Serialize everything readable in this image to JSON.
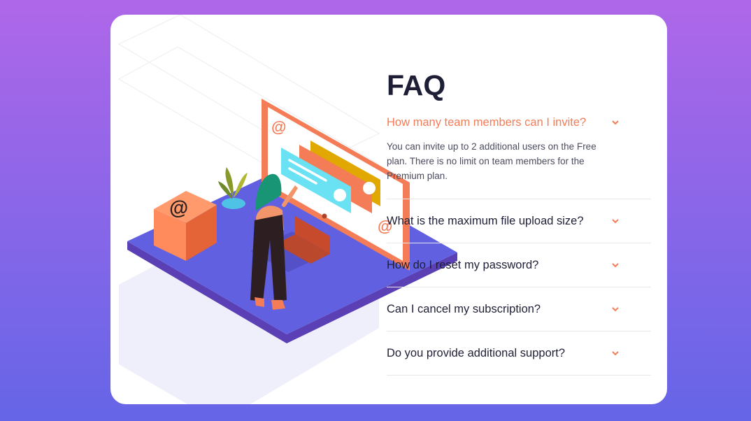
{
  "page": {
    "background_gradient": [
      "#af67e9",
      "#6565e7"
    ],
    "accent_color": "#f47c57",
    "text_color": "#1e1f36"
  },
  "faq": {
    "title": "FAQ",
    "items": [
      {
        "question": "How many team members can I invite?",
        "answer": "You can invite up to 2 additional users on the Free plan. There is no limit on team members for the Premium plan.",
        "expanded": true
      },
      {
        "question": "What is the maximum file upload size?",
        "expanded": false
      },
      {
        "question": "How do I reset my password?",
        "expanded": false
      },
      {
        "question": "Can I cancel my subscription?",
        "expanded": false
      },
      {
        "question": "Do you provide additional support?",
        "expanded": false
      }
    ]
  },
  "illustration": {
    "icon": "woman-at-online-monitor-illustration",
    "at_sign": "@"
  }
}
